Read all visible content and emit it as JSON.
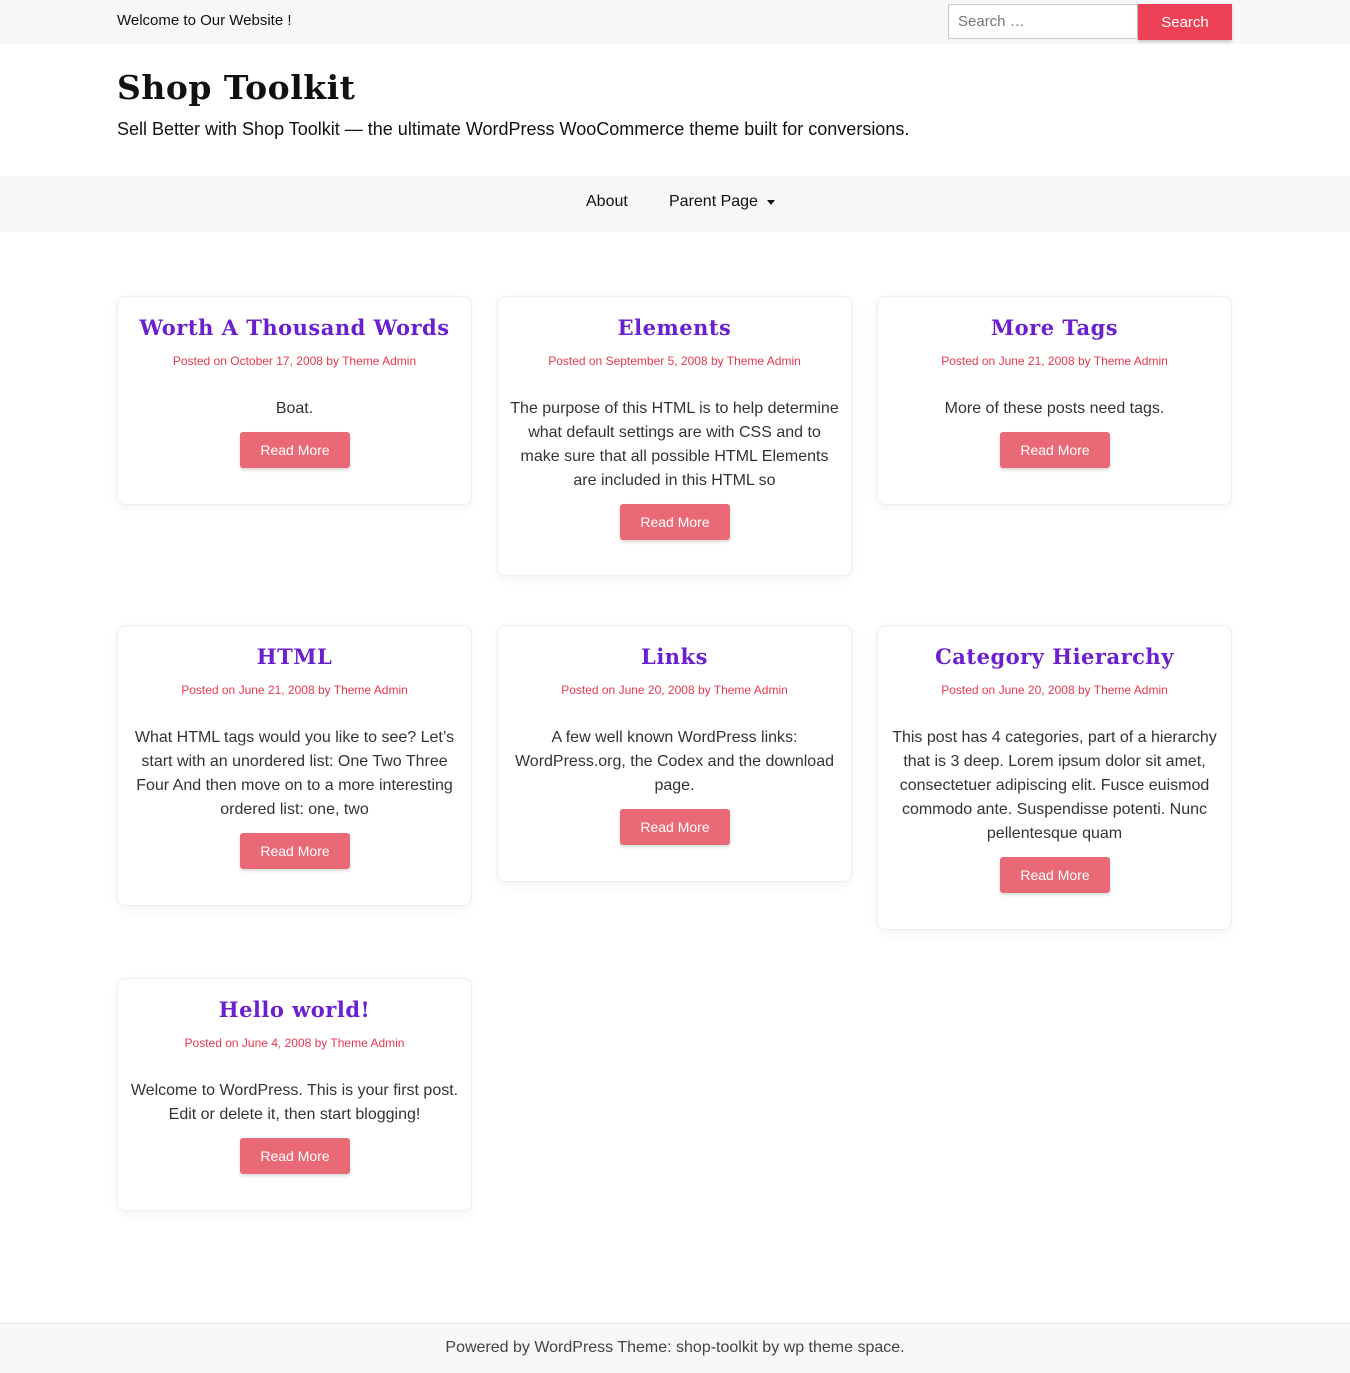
{
  "topbar": {
    "welcome": "Welcome to Our Website !",
    "search_placeholder": "Search …",
    "search_button": "Search"
  },
  "site": {
    "title": "Shop Toolkit",
    "description": "Sell Better with Shop Toolkit — the ultimate WordPress WooCommerce theme built for conversions."
  },
  "nav": {
    "items": [
      {
        "label": "About"
      },
      {
        "label": "Parent Page"
      }
    ]
  },
  "posts": [
    {
      "title": "Worth A Thousand Words",
      "meta": "Posted on October 17, 2008 by Theme Admin",
      "excerpt": "Boat.",
      "button": "Read More"
    },
    {
      "title": "Elements",
      "meta": "Posted on September 5, 2008 by Theme Admin",
      "excerpt": "The purpose of this HTML is to help determine what default settings are with CSS and to make sure that all possible HTML Elements are included in this HTML so",
      "button": "Read More"
    },
    {
      "title": "More Tags",
      "meta": "Posted on June 21, 2008 by Theme Admin",
      "excerpt": "More of these posts need tags.",
      "button": "Read More"
    },
    {
      "title": "HTML",
      "meta": "Posted on June 21, 2008 by Theme Admin",
      "excerpt": "What HTML tags would you like to see? Let’s start with an unordered list: One Two Three Four And then move on to a more interesting ordered list: one, two",
      "button": "Read More"
    },
    {
      "title": "Links",
      "meta": "Posted on June 20, 2008 by Theme Admin",
      "excerpt": "A few well known WordPress links: WordPress.org, the Codex and the download page.",
      "button": "Read More"
    },
    {
      "title": "Category Hierarchy",
      "meta": "Posted on June 20, 2008 by Theme Admin",
      "excerpt": "This post has 4 categories, part of a hierarchy that is 3 deep. Lorem ipsum dolor sit amet, consectetuer adipiscing elit. Fusce euismod commodo ante. Suspendisse potenti. Nunc pellentesque quam",
      "button": "Read More"
    },
    {
      "title": "Hello world!",
      "meta": "Posted on June 4, 2008 by Theme Admin",
      "excerpt": "Welcome to WordPress. This is your first post. Edit or delete it, then start blogging!",
      "button": "Read More"
    }
  ],
  "footer": {
    "credit": "Powered by WordPress Theme: shop-toolkit by wp theme space."
  }
}
